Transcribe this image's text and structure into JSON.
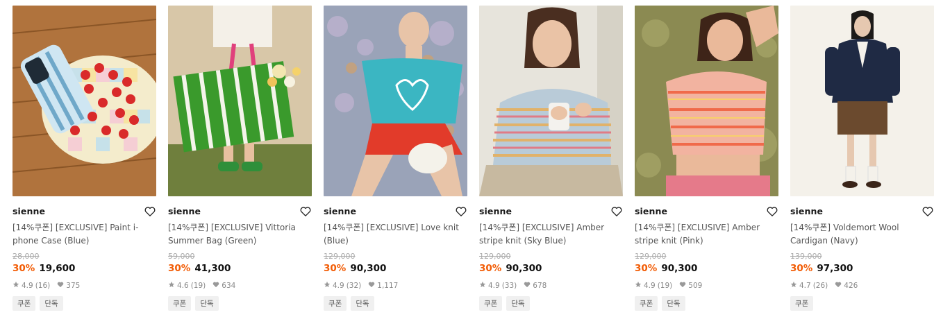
{
  "products": [
    {
      "brand": "sienne",
      "title": "[14%쿠폰] [EXCLUSIVE] Paint i-phone Case (Blue)",
      "original_price": "28,000",
      "discount": "30%",
      "price": "19,600",
      "rating": "4.9",
      "reviews": "(16)",
      "likes": "375",
      "tags": [
        "쿠폰",
        "단독"
      ]
    },
    {
      "brand": "sienne",
      "title": "[14%쿠폰] [EXCLUSIVE] Vittoria Summer Bag (Green)",
      "original_price": "59,000",
      "discount": "30%",
      "price": "41,300",
      "rating": "4.6",
      "reviews": "(19)",
      "likes": "634",
      "tags": [
        "쿠폰",
        "단독"
      ]
    },
    {
      "brand": "sienne",
      "title": "[14%쿠폰] [EXCLUSIVE] Love knit (Blue)",
      "original_price": "129,000",
      "discount": "30%",
      "price": "90,300",
      "rating": "4.9",
      "reviews": "(32)",
      "likes": "1,117",
      "tags": [
        "쿠폰",
        "단독"
      ]
    },
    {
      "brand": "sienne",
      "title": "[14%쿠폰] [EXCLUSIVE] Amber stripe knit (Sky Blue)",
      "original_price": "129,000",
      "discount": "30%",
      "price": "90,300",
      "rating": "4.9",
      "reviews": "(33)",
      "likes": "678",
      "tags": [
        "쿠폰",
        "단독"
      ]
    },
    {
      "brand": "sienne",
      "title": "[14%쿠폰] [EXCLUSIVE] Amber stripe knit (Pink)",
      "original_price": "129,000",
      "discount": "30%",
      "price": "90,300",
      "rating": "4.9",
      "reviews": "(19)",
      "likes": "509",
      "tags": [
        "쿠폰",
        "단독"
      ]
    },
    {
      "brand": "sienne",
      "title": "[14%쿠폰] Voldemort Wool Cardigan (Navy)",
      "original_price": "139,000",
      "discount": "30%",
      "price": "97,300",
      "rating": "4.7",
      "reviews": "(26)",
      "likes": "426",
      "tags": [
        "쿠폰"
      ]
    }
  ],
  "colors": {
    "discount": "#f25c05",
    "star": "#999999",
    "tag_bg": "#f0f0f0"
  }
}
